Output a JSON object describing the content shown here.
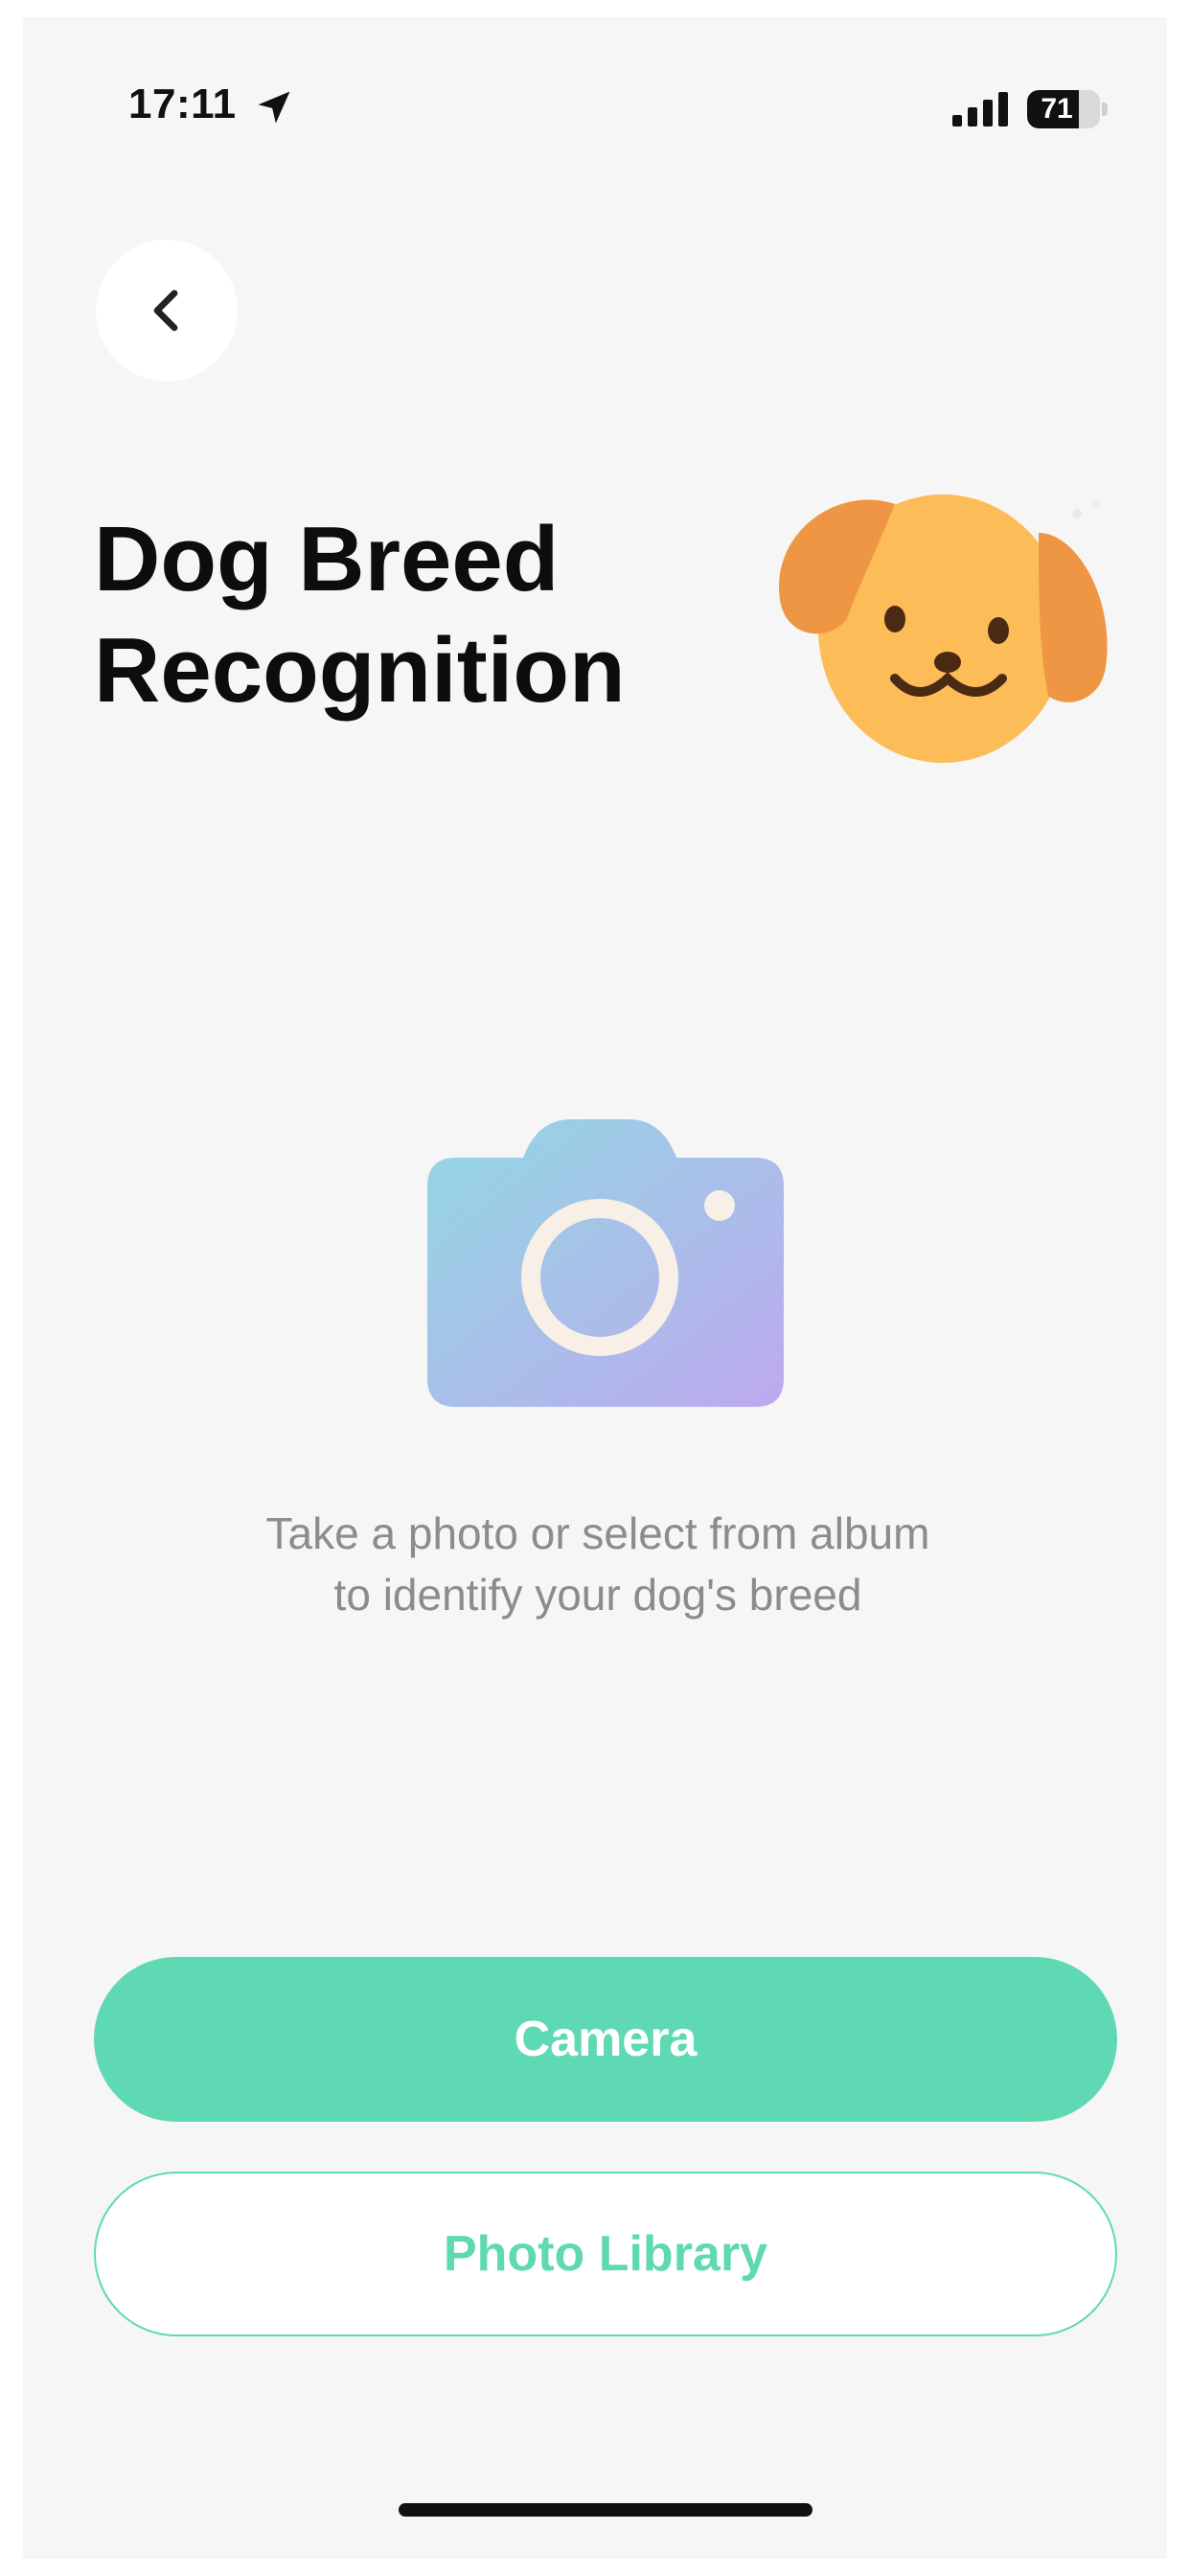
{
  "status_bar": {
    "time": "17:11",
    "battery_level": 71,
    "battery_label": "71"
  },
  "header": {
    "title_line1": "Dog Breed",
    "title_line2": "Recognition"
  },
  "instruction": {
    "line1": "Take a photo or select from album",
    "line2": "to identify your dog's breed"
  },
  "buttons": {
    "camera_label": "Camera",
    "library_label": "Photo Library"
  },
  "icons": {
    "back": "chevron-left-icon",
    "location": "location-arrow-icon",
    "signal": "cellular-signal-icon",
    "camera": "camera-icon",
    "mascot": "dog-face-icon"
  },
  "colors": {
    "accent": "#5ed9b3",
    "background": "#f6f6f6",
    "title": "#0d0d0d",
    "muted_text": "#8c8c8c"
  }
}
